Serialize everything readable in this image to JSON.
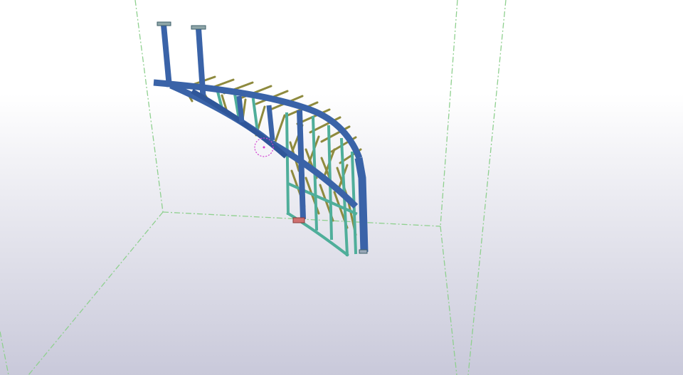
{
  "viewport": {
    "background_top": "#ffffff",
    "background_bottom": "#cbcbdb",
    "workplane_line_color": "#8fd08f"
  },
  "model": {
    "colors": {
      "main_member": "#3a63a8",
      "main_member_dark": "#2a4a86",
      "secondary_member": "#4fae9a",
      "bracing": "#8e8a3e",
      "plate": "#9aa8b8",
      "base_plate": "#d07070",
      "pick_indicator": "#d33fd3"
    }
  }
}
